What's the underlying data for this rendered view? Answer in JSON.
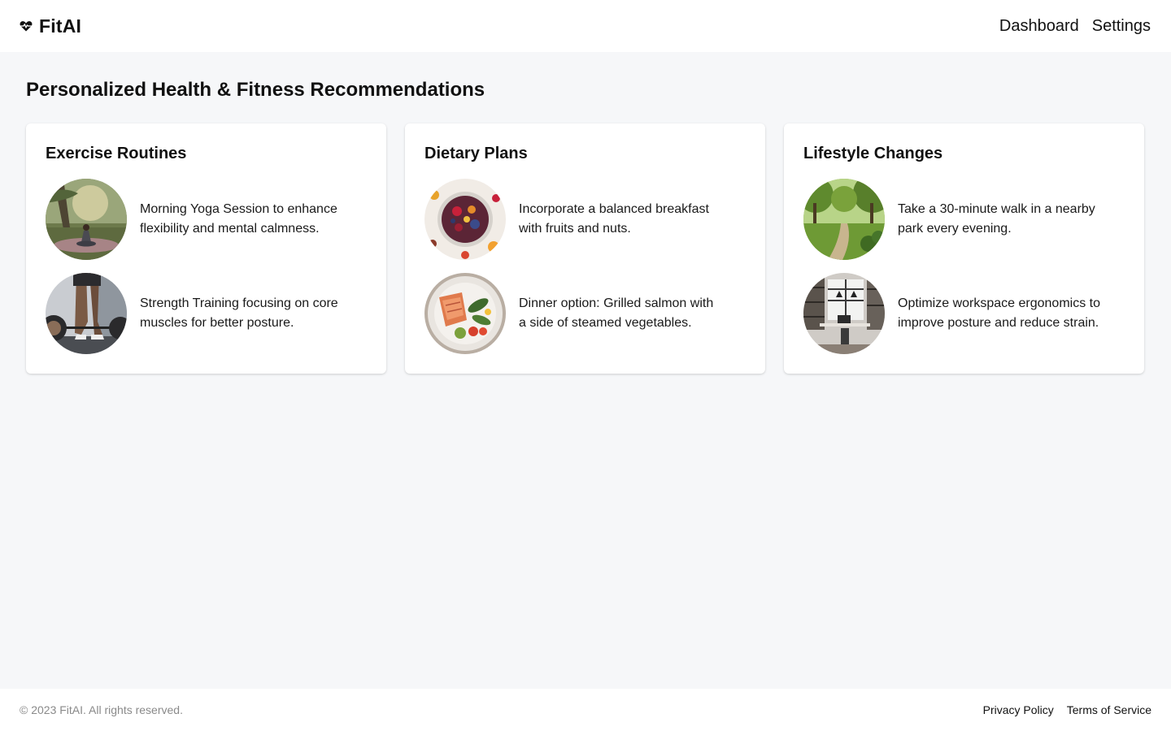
{
  "header": {
    "brand_name": "FitAI",
    "brand_icon": "heartbeat-icon",
    "nav": [
      {
        "label": "Dashboard"
      },
      {
        "label": "Settings"
      }
    ]
  },
  "main": {
    "title": "Personalized Health & Fitness Recommendations",
    "cards": [
      {
        "title": "Exercise Routines",
        "items": [
          {
            "text": "Morning Yoga Session to enhance flexibility and mental calmness.",
            "image": "yoga-photo"
          },
          {
            "text": "Strength Training focusing on core muscles for better posture.",
            "image": "barbell-photo"
          }
        ]
      },
      {
        "title": "Dietary Plans",
        "items": [
          {
            "text": "Incorporate a balanced breakfast with fruits and nuts.",
            "image": "fruit-bowl-photo"
          },
          {
            "text": "Dinner option: Grilled salmon with a side of steamed vegetables.",
            "image": "salmon-plate-photo"
          }
        ]
      },
      {
        "title": "Lifestyle Changes",
        "items": [
          {
            "text": "Take a 30-minute walk in a nearby park every evening.",
            "image": "park-path-photo"
          },
          {
            "text": "Optimize workspace ergonomics to improve posture and reduce strain.",
            "image": "workspace-photo"
          }
        ]
      }
    ]
  },
  "footer": {
    "copyright": "© 2023 FitAI. All rights reserved.",
    "links": [
      {
        "label": "Privacy Policy"
      },
      {
        "label": "Terms of Service"
      }
    ]
  },
  "colors": {
    "page_background": "#f6f7f9",
    "surface": "#ffffff",
    "text": "#111111",
    "muted_text": "#8a8a8a"
  }
}
